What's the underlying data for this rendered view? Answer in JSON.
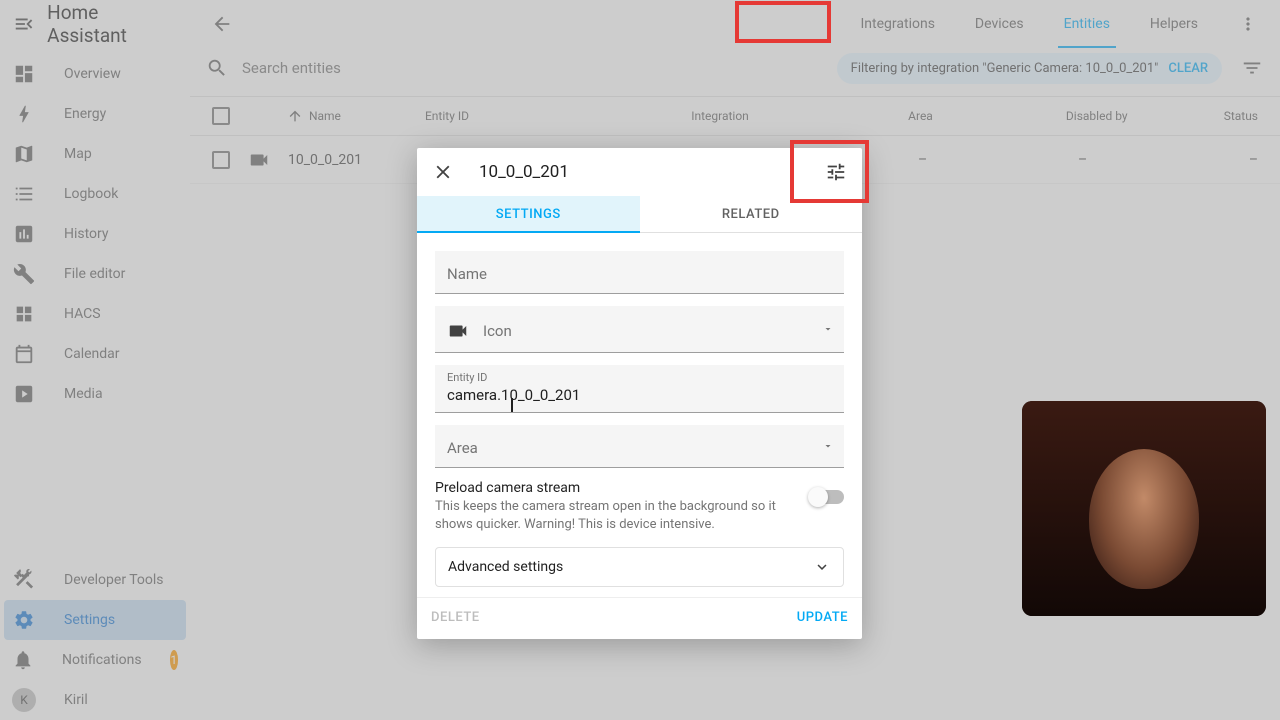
{
  "app": {
    "title": "Home Assistant"
  },
  "sidebar": {
    "items": [
      {
        "label": "Overview"
      },
      {
        "label": "Energy"
      },
      {
        "label": "Map"
      },
      {
        "label": "Logbook"
      },
      {
        "label": "History"
      },
      {
        "label": "File editor"
      },
      {
        "label": "HACS"
      },
      {
        "label": "Calendar"
      },
      {
        "label": "Media"
      }
    ],
    "bottom": {
      "dev_tools": "Developer Tools",
      "settings": "Settings",
      "notifications": "Notifications",
      "notifications_count": "1",
      "user_initial": "K",
      "user_name": "Kiril"
    }
  },
  "topbar": {
    "tabs": [
      {
        "label": "Integrations"
      },
      {
        "label": "Devices"
      },
      {
        "label": "Entities"
      },
      {
        "label": "Helpers"
      }
    ]
  },
  "search": {
    "placeholder": "Search entities",
    "filter_text": "Filtering by integration \"Generic Camera: 10_0_0_201\"",
    "clear_label": "CLEAR"
  },
  "table": {
    "headers": {
      "name": "Name",
      "entity_id": "Entity ID",
      "integration": "Integration",
      "area": "Area",
      "disabled_by": "Disabled by",
      "status": "Status"
    },
    "rows": [
      {
        "name": "10_0_0_201",
        "entity_id": "camera.10_0_0_201",
        "integration": "Generic Camera",
        "area": "–",
        "disabled_by": "–",
        "status": "–"
      }
    ]
  },
  "dialog": {
    "title": "10_0_0_201",
    "tabs": {
      "settings": "SETTINGS",
      "related": "RELATED"
    },
    "fields": {
      "name_label": "Name",
      "icon_label": "Icon",
      "entity_id_label": "Entity ID",
      "entity_id_value": "camera.10_0_0_201",
      "area_label": "Area"
    },
    "preload": {
      "title": "Preload camera stream",
      "desc": "This keeps the camera stream open in the background so it shows quicker. Warning! This is device intensive."
    },
    "advanced_label": "Advanced settings",
    "delete_label": "DELETE",
    "update_label": "UPDATE"
  }
}
